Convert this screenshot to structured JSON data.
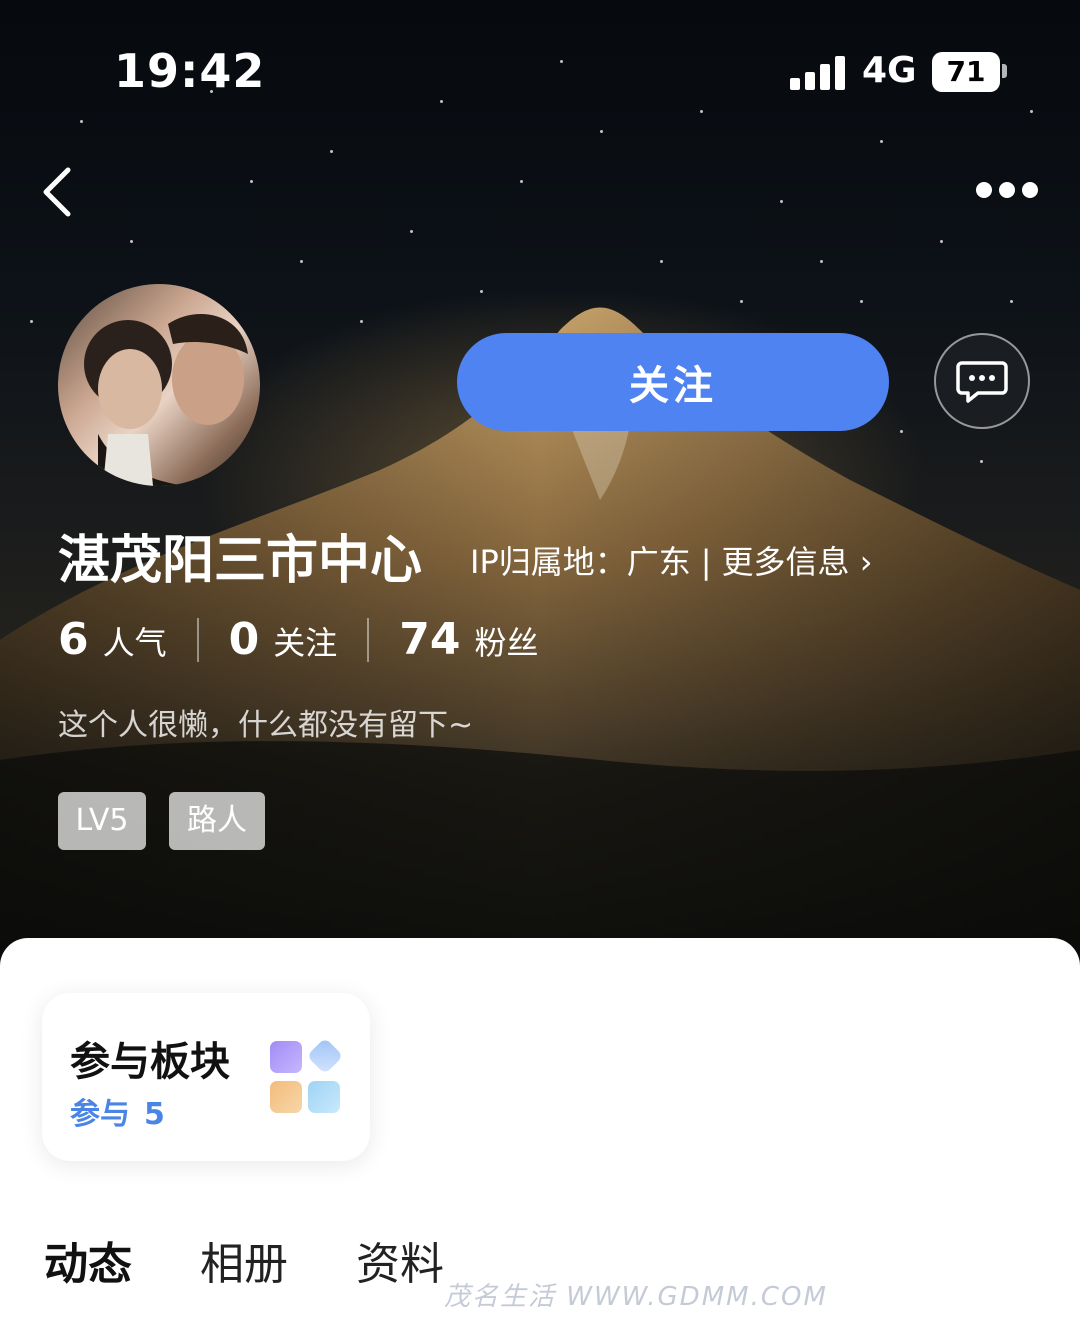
{
  "status_bar": {
    "time": "19:42",
    "network": "4G",
    "battery": "71"
  },
  "profile": {
    "name": "湛茂阳三市中心",
    "ip_label": "IP归属地：广东",
    "more_info": "更多信息",
    "bio": "这个人很懒，什么都没有留下~",
    "follow_label": "关注",
    "stats": [
      {
        "value": "6",
        "label": "人气"
      },
      {
        "value": "0",
        "label": "关注"
      },
      {
        "value": "74",
        "label": "粉丝"
      }
    ],
    "badges": [
      "LV5",
      "路人"
    ]
  },
  "card": {
    "title": "参与板块",
    "sub_label": "参与",
    "sub_value": "5"
  },
  "tabs": [
    "动态",
    "相册",
    "资料"
  ],
  "watermark": "茂名生活 WWW.GDMM.COM",
  "colors": {
    "accent": "#4f83f1",
    "card_sub": "#4a84e6"
  }
}
